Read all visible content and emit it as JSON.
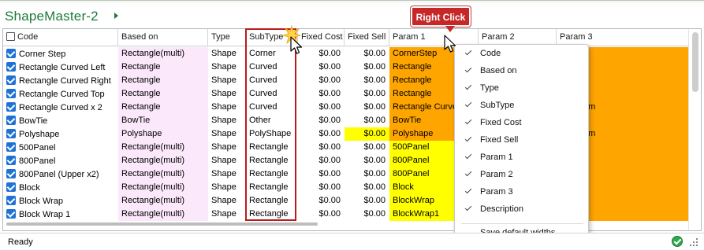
{
  "app": {
    "title": "ShapeMaster-2"
  },
  "columns": [
    {
      "key": "code",
      "label": "Code"
    },
    {
      "key": "based_on",
      "label": "Based on"
    },
    {
      "key": "type",
      "label": "Type"
    },
    {
      "key": "subtype",
      "label": "SubType"
    },
    {
      "key": "fixed_cost",
      "label": "Fixed Cost"
    },
    {
      "key": "fixed_sell",
      "label": "Fixed Sell"
    },
    {
      "key": "param1",
      "label": "Param 1"
    },
    {
      "key": "param2",
      "label": "Param 2"
    },
    {
      "key": "param3",
      "label": "Param 3"
    }
  ],
  "rows": [
    {
      "code": "Corner Step",
      "based_on": "Rectangle(multi)",
      "type": "Shape",
      "subtype": "Corner",
      "fixed_cost": "$0.00",
      "fixed_sell": "$0.00",
      "param1": "CornerStep",
      "param3": ""
    },
    {
      "code": "Rectangle Curved Left",
      "based_on": "Rectangle",
      "type": "Shape",
      "subtype": "Curved",
      "fixed_cost": "$0.00",
      "fixed_sell": "$0.00",
      "param1": "Rectangle",
      "param3": ""
    },
    {
      "code": "Rectangle Curved Right",
      "based_on": "Rectangle",
      "type": "Shape",
      "subtype": "Curved",
      "fixed_cost": "$0.00",
      "fixed_sell": "$0.00",
      "param1": "Rectangle",
      "param3": ""
    },
    {
      "code": "Rectangle Curved Top",
      "based_on": "Rectangle",
      "type": "Shape",
      "subtype": "Curved",
      "fixed_cost": "$0.00",
      "fixed_sell": "$0.00",
      "param1": "Rectangle",
      "param3": ""
    },
    {
      "code": "Rectangle Curved x 2",
      "based_on": "Rectangle",
      "type": "Shape",
      "subtype": "Curved",
      "fixed_cost": "$0.00",
      "fixed_sell": "$0.00",
      "param1": "Rectangle Curved",
      "param3": "x 400mm"
    },
    {
      "code": "BowTie",
      "based_on": "BowTie",
      "type": "Shape",
      "subtype": "Other",
      "fixed_cost": "$0.00",
      "fixed_sell": "$0.00",
      "param1": "BowTie",
      "param3": ""
    },
    {
      "code": "Polyshape",
      "based_on": "Polyshape",
      "type": "Shape",
      "subtype": "PolyShape",
      "fixed_cost": "$0.00",
      "fixed_sell": "$0.00",
      "param1": "Polyshape",
      "param3": "x 750mm"
    },
    {
      "code": "500Panel",
      "based_on": "Rectangle(multi)",
      "type": "Shape",
      "subtype": "Rectangle",
      "fixed_cost": "$0.00",
      "fixed_sell": "$0.00",
      "param1": "500Panel",
      "param3": ""
    },
    {
      "code": "800Panel",
      "based_on": "Rectangle(multi)",
      "type": "Shape",
      "subtype": "Rectangle",
      "fixed_cost": "$0.00",
      "fixed_sell": "$0.00",
      "param1": "800Panel",
      "param3": ""
    },
    {
      "code": "800Panel (Upper x2)",
      "based_on": "Rectangle(multi)",
      "type": "Shape",
      "subtype": "Rectangle",
      "fixed_cost": "$0.00",
      "fixed_sell": "$0.00",
      "param1": "800Panel",
      "param3": ""
    },
    {
      "code": "Block",
      "based_on": "Rectangle(multi)",
      "type": "Shape",
      "subtype": "Rectangle",
      "fixed_cost": "$0.00",
      "fixed_sell": "$0.00",
      "param1": "Block",
      "param3": ""
    },
    {
      "code": "Block Wrap",
      "based_on": "Rectangle(multi)",
      "type": "Shape",
      "subtype": "Rectangle",
      "fixed_cost": "$0.00",
      "fixed_sell": "$0.00",
      "param1": "BlockWrap",
      "param3": ""
    },
    {
      "code": "Block Wrap 1",
      "based_on": "Rectangle(multi)",
      "type": "Shape",
      "subtype": "Rectangle",
      "fixed_cost": "$0.00",
      "fixed_sell": "$0.00",
      "param1": "BlockWrap1",
      "param3": ""
    }
  ],
  "context_menu": {
    "items": [
      {
        "label": "Code",
        "checked": true
      },
      {
        "label": "Based on",
        "checked": true
      },
      {
        "label": "Type",
        "checked": true
      },
      {
        "label": "SubType",
        "checked": true
      },
      {
        "label": "Fixed Cost",
        "checked": true
      },
      {
        "label": "Fixed Sell",
        "checked": true
      },
      {
        "label": "Param 1",
        "checked": true
      },
      {
        "label": "Param 2",
        "checked": true
      },
      {
        "label": "Param 3",
        "checked": true
      },
      {
        "label": "Description",
        "checked": true
      }
    ],
    "footer_label": "Save default widths"
  },
  "callout": {
    "label": "Right Click"
  },
  "status": {
    "text": "Ready"
  },
  "colors": {
    "based_on_bg": "#fce8fb",
    "param_bg": "#ffa500",
    "param_yellow_bg": "#ffff00",
    "highlight_border": "#b91c1c",
    "title_green": "#1e7a3c",
    "checkbox_blue": "#1e72d6"
  }
}
